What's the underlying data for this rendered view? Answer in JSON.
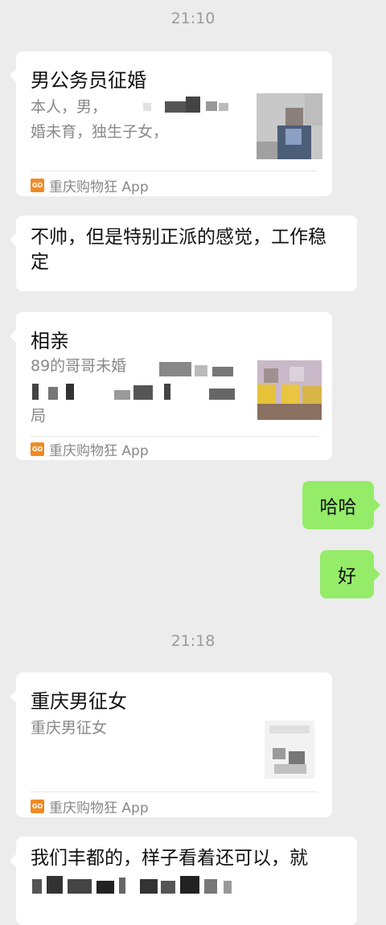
{
  "times": [
    "21:10",
    "21:18"
  ],
  "messages": {
    "card1": {
      "title": "男公务员征婚",
      "desc_line1": "本人，男，",
      "desc_line2": "婚未育，独生子女，",
      "source": "重庆购物狂 App",
      "icon": "GO"
    },
    "text1": {
      "text": "不帅，但是特别正派的感觉，工作稳定"
    },
    "card2": {
      "title": "相亲",
      "desc_line1": "89的哥哥未婚",
      "desc_line3": "局",
      "source": "重庆购物狂 App",
      "icon": "GO"
    },
    "me1": {
      "text": "哈哈"
    },
    "me2": {
      "text": "好"
    },
    "card3": {
      "title": "重庆男征女",
      "desc_line1": "重庆男征女",
      "source": "重庆购物狂 App",
      "icon": "GO"
    },
    "text2": {
      "text": "我们丰都的，样子看着还可以，就"
    }
  },
  "colors": {
    "background": "#ececec",
    "my_bubble": "#95ec69",
    "source_icon": "#f08a24"
  }
}
